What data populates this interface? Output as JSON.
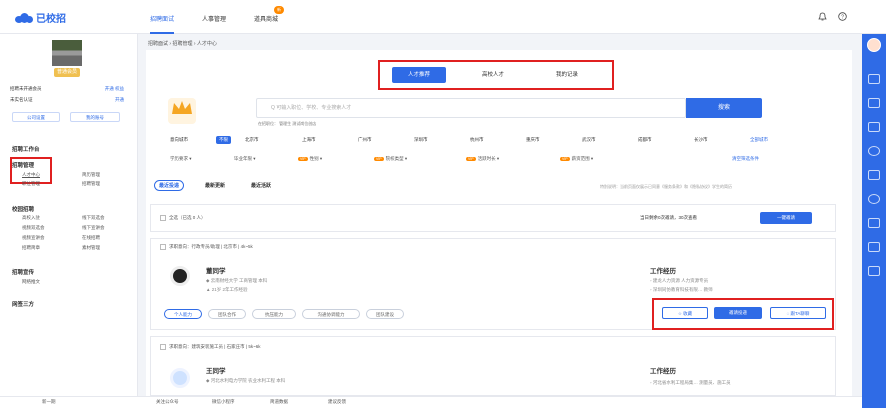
{
  "app": {
    "logo": "已校招"
  },
  "topnav": [
    "招聘面试",
    "人事管理",
    "道具商城"
  ],
  "topnav_badge": "新",
  "sidebar": {
    "vip_tag": "普通会员",
    "rows": [
      {
        "left": "招聘未开通会员",
        "right": "开通 权益"
      },
      {
        "left": "未实名认证",
        "right": "开通"
      }
    ],
    "btn_company": "公司设置",
    "btn_account": "我的账号",
    "section_work": "招聘工作台",
    "section_manage": "招聘管理",
    "manage_items": [
      [
        "人才中心",
        "简历管理"
      ],
      [
        "职位管理",
        "招聘管理"
      ]
    ],
    "section_campus": "校园招聘",
    "campus_items": [
      [
        "高校入驻",
        "线下双选会"
      ],
      [
        "视频双选会",
        "线下宣讲会"
      ],
      [
        "视频宣讲会",
        "在线招聘"
      ],
      [
        "招聘简章",
        "素材管理"
      ]
    ],
    "section_promo": "招聘宣传",
    "promo_items": [
      "网络推文"
    ],
    "section_third": "网签三方",
    "bottom": "新一期"
  },
  "breadcrumb": "招聘面试 › 招聘管理 › 人才中心",
  "tabs": [
    "人才推荐",
    "高校人才",
    "我的记录"
  ],
  "search": {
    "placeholder": "Q 可输入职位、学校、专业搜索人才",
    "button": "搜索",
    "hint": "在招职位：  管理生   测试岗位创店"
  },
  "cities": {
    "label": "意向城市",
    "unlimited": "不限",
    "list": [
      "北京市",
      "上海市",
      "广州市",
      "深圳市",
      "杭州市",
      "重庆市",
      "武汉市",
      "成都市",
      "长沙市"
    ],
    "all": "全部城市"
  },
  "filters": [
    "学历要求",
    "毕业年限",
    "性别",
    "院校类型",
    "活跃时长",
    "薪资范围"
  ],
  "filter_clear": "清空筛选条件",
  "sort_tabs": [
    "最近投递",
    "最新更新",
    "最近活跃"
  ],
  "notice": "特别说明：当前页面仅展示已同意《服务条款》和《隐私协议》学生的简历",
  "select_all": "全选（已选 0 人）",
  "quota": "当日剩余0次邀请，30次查看",
  "batch_btn": "一键邀请",
  "candidates": [
    {
      "intent": "求职意向：行政专员/助理 | 北京市 | 4k~5k",
      "name": "董同学",
      "school": "云南财经大学 工商管理 本科",
      "years": "21岁 2年工作经验",
      "exp_title": "工作经历",
      "exp": "建龙人力资源  人力资源专员",
      "exp2": "深圳同仿教育科技有限…  教师",
      "tags": [
        "个人能力",
        "团队合作",
        "抗压能力",
        "沟通协调能力",
        "团队建设"
      ],
      "btn_fav": "收藏",
      "btn_invite": "邀请投递",
      "btn_chat": "跟TA聊聊"
    },
    {
      "intent": "求职意向：建筑安装施工员 | 石家庄市 | 5k~6k",
      "name": "王同学",
      "school": "河北水利电力学院 农业水利工程 本科",
      "years": "",
      "exp_title": "工作经历",
      "exp": "河北省水利工程局集…  测量员、施工员"
    }
  ],
  "bottombar": [
    "关注公众号",
    "微信小程序",
    "简道数据",
    "建议反馈"
  ],
  "colors": {
    "accent": "#2f6be6",
    "highlight": "#e02020"
  }
}
